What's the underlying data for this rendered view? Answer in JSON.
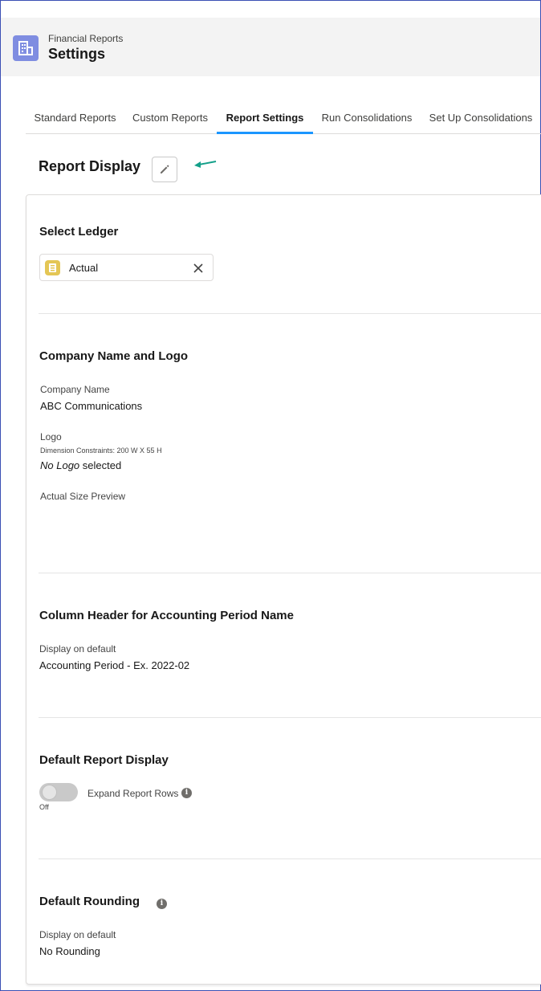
{
  "header": {
    "app_subtitle": "Financial Reports",
    "app_title": "Settings",
    "app_icon": "report-grid-icon"
  },
  "tabs": [
    {
      "label": "Standard Reports",
      "active": false
    },
    {
      "label": "Custom Reports",
      "active": false
    },
    {
      "label": "Report Settings",
      "active": true
    },
    {
      "label": "Run Consolidations",
      "active": false
    },
    {
      "label": "Set Up Consolidations",
      "active": false
    }
  ],
  "report_display": {
    "title": "Report Display",
    "edit_icon": "pencil-icon"
  },
  "select_ledger": {
    "title": "Select Ledger",
    "selected": "Actual"
  },
  "company": {
    "title": "Company Name and Logo",
    "name_label": "Company Name",
    "name_value": "ABC Communications",
    "logo_label": "Logo",
    "logo_constraints": "Dimension Constraints: 200 W X 55 H",
    "logo_value_italic": "No Logo",
    "logo_value_rest": " selected",
    "preview_label": "Actual Size Preview"
  },
  "column_header": {
    "title": "Column Header for Accounting Period Name",
    "label": "Display on default",
    "value": "Accounting Period - Ex. 2022-02"
  },
  "default_display": {
    "title": "Default Report Display",
    "toggle_label": "Expand Report Rows",
    "toggle_state": "Off"
  },
  "rounding": {
    "title": "Default Rounding",
    "label": "Display on default",
    "value": "No Rounding"
  },
  "colors": {
    "accent": "#1b96ff",
    "app_icon_bg": "#7f8de1",
    "ledger_icon_bg": "#e4c655",
    "arrow": "#14a08a"
  }
}
